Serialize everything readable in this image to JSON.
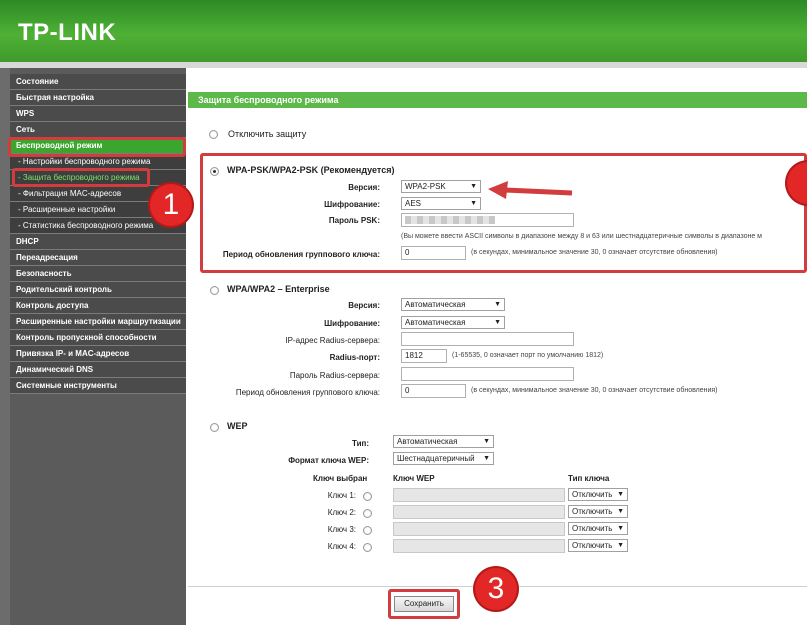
{
  "header": {
    "logo": "TP-LINK"
  },
  "sidebar": {
    "items": [
      {
        "label": "Состояние"
      },
      {
        "label": "Быстрая настройка"
      },
      {
        "label": "WPS"
      },
      {
        "label": "Сеть"
      },
      {
        "label": "Беспроводной режим"
      },
      {
        "label": "- Настройки беспроводного режима"
      },
      {
        "label": "- Защита беспроводного режима"
      },
      {
        "label": "- Фильтрация MAC-адресов"
      },
      {
        "label": "- Расширенные настройки"
      },
      {
        "label": "- Статистика беспроводного режима"
      },
      {
        "label": "DHCP"
      },
      {
        "label": "Переадресация"
      },
      {
        "label": "Безопасность"
      },
      {
        "label": "Родительский контроль"
      },
      {
        "label": "Контроль доступа"
      },
      {
        "label": "Расширенные настройки маршрутизации"
      },
      {
        "label": "Контроль пропускной способности"
      },
      {
        "label": "Привязка IP- и MAC-адресов"
      },
      {
        "label": "Динамический DNS"
      },
      {
        "label": "Системные инструменты"
      }
    ]
  },
  "main": {
    "title": "Защита беспроводного режима",
    "disable": {
      "label": "Отключить защиту"
    },
    "wpa_psk": {
      "label": "WPA-PSK/WPA2-PSK (Рекомендуется)",
      "version_label": "Версия:",
      "version_value": "WPA2-PSK",
      "encryption_label": "Шифрование:",
      "encryption_value": "AES",
      "psk_label": "Пароль PSK:",
      "psk_note": "(Вы можете ввести ASCII символы в диапазоне между 8 и 63 или шестнадцатеричные символы в диапазоне м",
      "group_key_label": "Период обновления группового ключа:",
      "group_key_value": "0",
      "group_key_note": "(в секундах, минимальное значение 30, 0 означает отсутствие обновления)"
    },
    "wpa_enterprise": {
      "label": "WPA/WPA2 – Enterprise",
      "version_label": "Версия:",
      "version_value": "Автоматическая",
      "encryption_label": "Шифрование:",
      "encryption_value": "Автоматическая",
      "radius_ip_label": "IP-адрес Radius-сервера:",
      "radius_port_label": "Radius-порт:",
      "radius_port_value": "1812",
      "radius_port_note": "(1-65535, 0 означает порт по умолчанию 1812)",
      "radius_pass_label": "Пароль Radius-сервера:",
      "group_key_label": "Период обновления группового ключа:",
      "group_key_value": "0",
      "group_key_note": "(в секундах, минимальное значение 30, 0 означает отсутствие обновления)"
    },
    "wep": {
      "label": "WEP",
      "type_label": "Тип:",
      "type_value": "Автоматическая",
      "format_label": "Формат ключа WEP:",
      "format_value": "Шестнадцатеричный",
      "col_selected": "Ключ выбран",
      "col_key": "Ключ WEP",
      "col_type": "Тип ключа",
      "keys": [
        {
          "label": "Ключ 1:",
          "type": "Отключить"
        },
        {
          "label": "Ключ 2:",
          "type": "Отключить"
        },
        {
          "label": "Ключ 3:",
          "type": "Отключить"
        },
        {
          "label": "Ключ 4:",
          "type": "Отключить"
        }
      ]
    },
    "save_label": "Сохранить"
  },
  "annotations": {
    "badge1": "1",
    "badge3": "3"
  },
  "colors": {
    "accent": "#5cb848",
    "highlight": "#d23c3c",
    "badge": "#e32626"
  }
}
